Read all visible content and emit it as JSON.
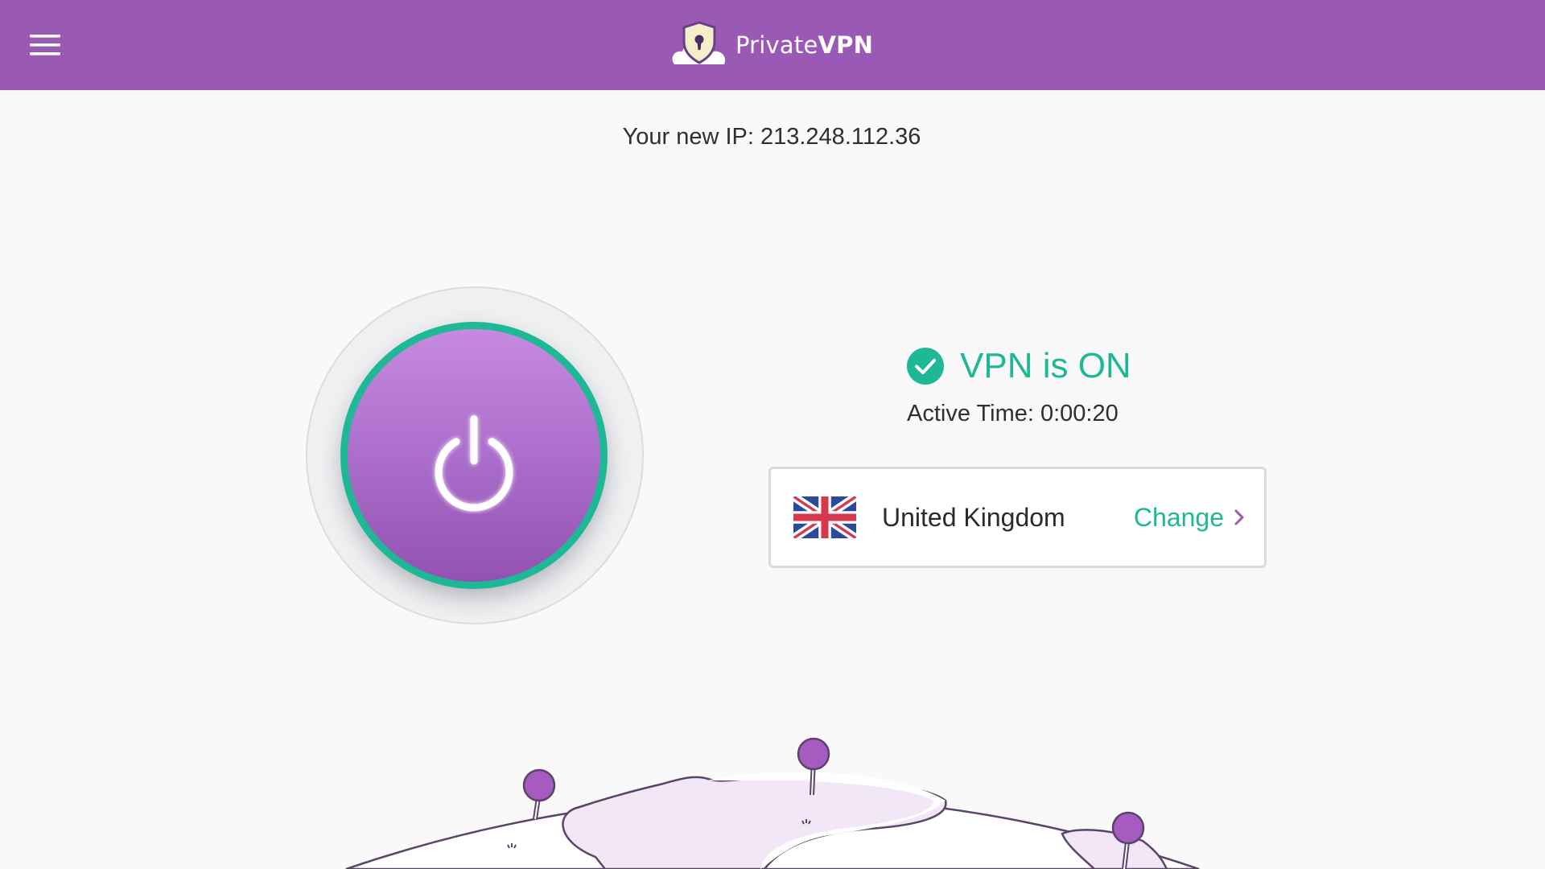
{
  "header": {
    "brand_light": "Private",
    "brand_bold": "VPN",
    "menu_icon": "hamburger-menu-icon",
    "logo_icon": "shield-keyhole-cloud-icon"
  },
  "ip": {
    "text": "Your new IP: 213.248.112.36"
  },
  "power": {
    "icon": "power-icon",
    "state": "on"
  },
  "status": {
    "icon": "check-circle-icon",
    "text": "VPN is ON",
    "active_time": "Active Time: 0:00:20"
  },
  "location": {
    "country": "United Kingdom",
    "flag_icon": "uk-flag-icon",
    "change_label": "Change",
    "chevron_icon": "chevron-right-icon"
  },
  "colors": {
    "header": "#9b59b6",
    "accent_green": "#1fb896",
    "button_purple": "#ab6ecb",
    "background": "#f9f9f9"
  }
}
